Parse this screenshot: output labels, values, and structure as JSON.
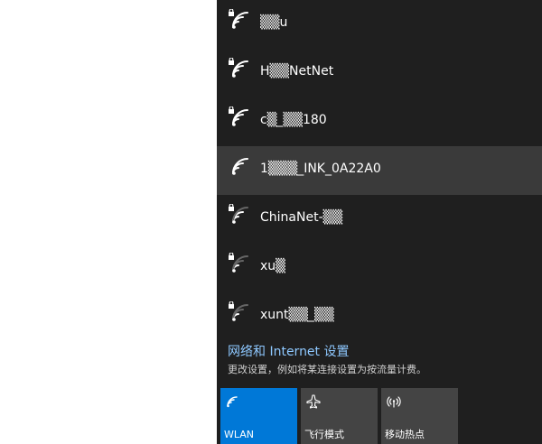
{
  "networks": [
    {
      "ssid": "▒▒u",
      "secured": true,
      "signal": 3,
      "selected": false
    },
    {
      "ssid": "H▒▒NetNet",
      "secured": true,
      "signal": 3,
      "selected": false
    },
    {
      "ssid": "c▒_▒▒180",
      "secured": true,
      "signal": 3,
      "selected": false
    },
    {
      "ssid": "1▒▒▒_INK_0A22A0",
      "secured": false,
      "signal": 3,
      "selected": true
    },
    {
      "ssid": "ChinaNet-▒▒",
      "secured": true,
      "signal": 2,
      "selected": false
    },
    {
      "ssid": "xu▒",
      "secured": true,
      "signal": 1,
      "selected": false
    },
    {
      "ssid": "xunt▒▒_▒▒",
      "secured": true,
      "signal": 1,
      "selected": false
    }
  ],
  "settings": {
    "link": "网络和 Internet 设置",
    "description": "更改设置，例如将某连接设置为按流量计费。"
  },
  "tiles": [
    {
      "label": "WLAN",
      "icon": "wifi-icon",
      "active": true
    },
    {
      "label": "飞行模式",
      "icon": "airplane-icon",
      "active": false
    },
    {
      "label": "移动热点",
      "icon": "hotspot-icon",
      "active": false
    }
  ],
  "colors": {
    "flyout_bg": "#1f1f1f",
    "selected_bg": "#3a3a3a",
    "accent": "#0078d7",
    "link": "#8ec8ff",
    "tile_bg": "#444444"
  }
}
